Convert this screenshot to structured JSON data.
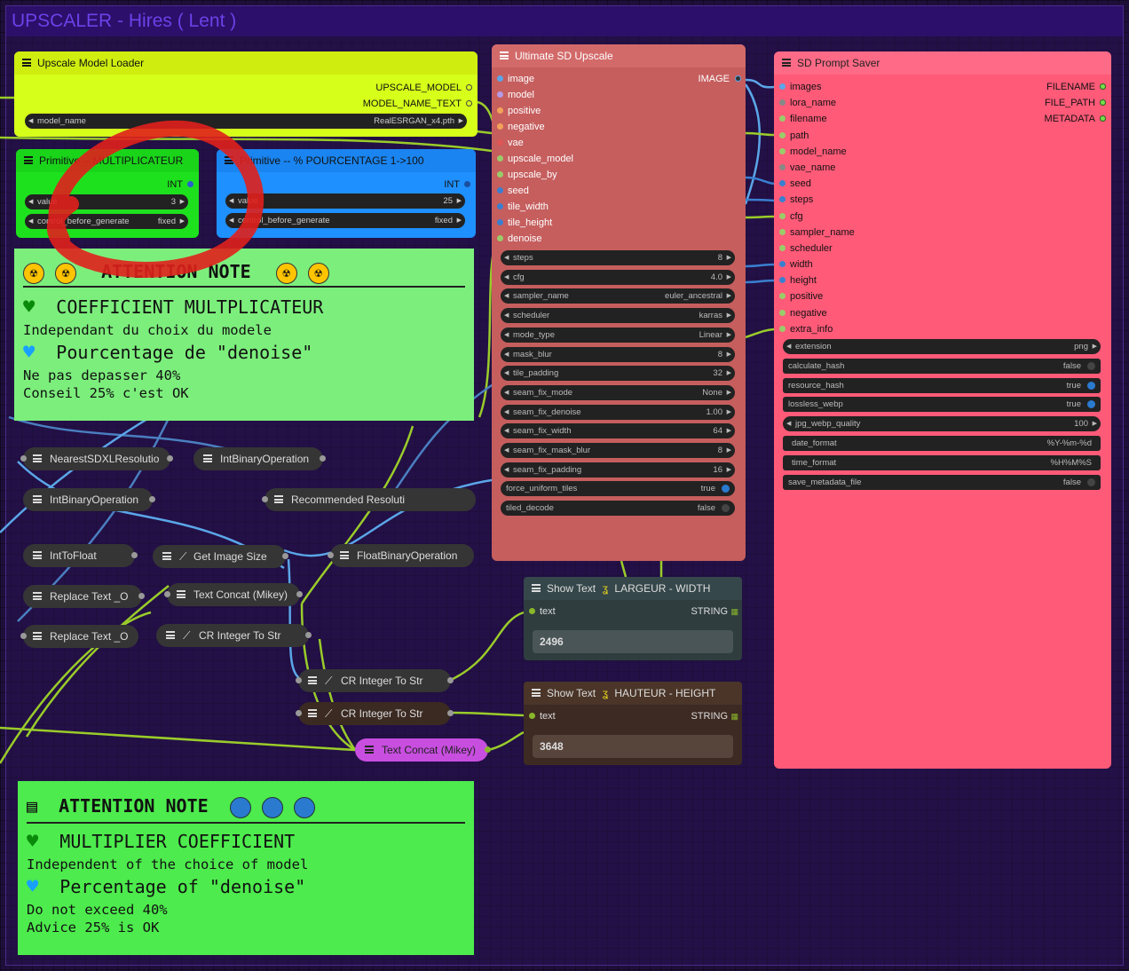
{
  "group": {
    "title": "UPSCALER - Hires  ( Lent )"
  },
  "upscale_loader": {
    "title": "Upscale Model Loader",
    "outputs": [
      "UPSCALE_MODEL",
      "MODEL_NAME_TEXT"
    ],
    "widget": {
      "label": "model_name",
      "value": "RealESRGAN_x4.pth"
    }
  },
  "prim_mult": {
    "title": "Primitive -- MULTIPLICATEUR",
    "output": "INT",
    "widgets": [
      {
        "label": "value",
        "value": "3"
      },
      {
        "label": "control_before_generate",
        "value": "fixed"
      }
    ]
  },
  "prim_pct": {
    "title": "Primitive -- % POURCENTAGE 1->100",
    "output": "INT",
    "widgets": [
      {
        "label": "value",
        "value": "25"
      },
      {
        "label": "control_before_generate",
        "value": "fixed"
      }
    ]
  },
  "note_fr": {
    "header": "ATTENTION NOTE",
    "line1": "COEFFICIENT MULTPLICATEUR",
    "line2": "Independant du choix du modele",
    "line3": "Pourcentage de \"denoise\"",
    "line4": "Ne pas depasser 40%",
    "line5": "Conseil 25% c'est OK"
  },
  "note_en": {
    "header": "ATTENTION NOTE",
    "line1": "MULTIPLIER COEFFICIENT",
    "line2": "Independent of the choice of model",
    "line3": "Percentage of \"denoise\"",
    "line4": "Do not exceed 40%",
    "line5": "Advice 25% is OK"
  },
  "ultimate": {
    "title": "Ultimate SD Upscale",
    "output": "IMAGE",
    "inputs": [
      {
        "name": "image",
        "color": "#5aa6e8"
      },
      {
        "name": "model",
        "color": "#b69ae6"
      },
      {
        "name": "positive",
        "color": "#f2a35a"
      },
      {
        "name": "negative",
        "color": "#f2a35a"
      },
      {
        "name": "vae",
        "color": "#e05555"
      },
      {
        "name": "upscale_model",
        "color": "#9acc6a"
      },
      {
        "name": "upscale_by",
        "color": "#9acc6a"
      },
      {
        "name": "seed",
        "color": "#3a7fd0"
      },
      {
        "name": "tile_width",
        "color": "#3a7fd0"
      },
      {
        "name": "tile_height",
        "color": "#3a7fd0"
      },
      {
        "name": "denoise",
        "color": "#9acc6a"
      }
    ],
    "widgets": [
      {
        "label": "steps",
        "value": "8"
      },
      {
        "label": "cfg",
        "value": "4.0"
      },
      {
        "label": "sampler_name",
        "value": "euler_ancestral"
      },
      {
        "label": "scheduler",
        "value": "karras"
      },
      {
        "label": "mode_type",
        "value": "Linear"
      },
      {
        "label": "mask_blur",
        "value": "8"
      },
      {
        "label": "tile_padding",
        "value": "32"
      },
      {
        "label": "seam_fix_mode",
        "value": "None"
      },
      {
        "label": "seam_fix_denoise",
        "value": "1.00"
      },
      {
        "label": "seam_fix_width",
        "value": "64"
      },
      {
        "label": "seam_fix_mask_blur",
        "value": "8"
      },
      {
        "label": "seam_fix_padding",
        "value": "16"
      }
    ],
    "toggles": [
      {
        "label": "force_uniform_tiles",
        "value": "true"
      },
      {
        "label": "tiled_decode",
        "value": "false"
      }
    ]
  },
  "prompt_saver": {
    "title": "SD Prompt Saver",
    "outputs": [
      "FILENAME",
      "FILE_PATH",
      "METADATA"
    ],
    "inputs": [
      {
        "name": "images",
        "color": "#5aa6e8"
      },
      {
        "name": "lora_name",
        "color": "#888888"
      },
      {
        "name": "filename",
        "color": "#9acc6a"
      },
      {
        "name": "path",
        "color": "#9acc6a"
      },
      {
        "name": "model_name",
        "color": "#9acc6a"
      },
      {
        "name": "vae_name",
        "color": "#888888"
      },
      {
        "name": "seed",
        "color": "#3a7fd0"
      },
      {
        "name": "steps",
        "color": "#3a7fd0"
      },
      {
        "name": "cfg",
        "color": "#9acc6a"
      },
      {
        "name": "sampler_name",
        "color": "#9acc6a"
      },
      {
        "name": "scheduler",
        "color": "#9acc6a"
      },
      {
        "name": "width",
        "color": "#3a7fd0"
      },
      {
        "name": "height",
        "color": "#3a7fd0"
      },
      {
        "name": "positive",
        "color": "#9acc6a"
      },
      {
        "name": "negative",
        "color": "#9acc6a"
      },
      {
        "name": "extra_info",
        "color": "#9acc6a"
      }
    ],
    "widgets": [
      {
        "label": "extension",
        "value": "png",
        "kind": "combo"
      },
      {
        "label": "calculate_hash",
        "value": "false",
        "kind": "toggle"
      },
      {
        "label": "resource_hash",
        "value": "true",
        "kind": "toggle"
      },
      {
        "label": "lossless_webp",
        "value": "true",
        "kind": "toggle"
      },
      {
        "label": "jpg_webp_quality",
        "value": "100",
        "kind": "combo"
      },
      {
        "label": "date_format",
        "value": "%Y-%m-%d",
        "kind": "text"
      },
      {
        "label": "time_format",
        "value": "%H%M%S",
        "kind": "text"
      },
      {
        "label": "save_metadata_file",
        "value": "false",
        "kind": "toggle"
      }
    ]
  },
  "collapsed": {
    "nearest": "NearestSDXLResolutio",
    "intbin1": "IntBinaryOperation",
    "intbin2": "IntBinaryOperation",
    "recommended": "Recommended Resoluti",
    "inttofloat": "IntToFloat",
    "getimagesize": "Get Image Size",
    "floatbin": "FloatBinaryOperation",
    "replace1": "Replace Text _O",
    "textconcat1": "Text Concat (Mikey)",
    "replace2": "Replace Text _O",
    "crint1": "CR Integer To Str",
    "crint2": "CR Integer To Str",
    "crint3": "CR Integer To Str",
    "textconcat2": "Text Concat (Mikey)"
  },
  "show_width": {
    "title": "Show Text",
    "suffix": "LARGEUR - WIDTH",
    "input": "text",
    "output": "STRING",
    "value": "2496"
  },
  "show_height": {
    "title": "Show Text",
    "suffix": "HAUTEUR - HEIGHT",
    "input": "text",
    "output": "STRING",
    "value": "3648"
  },
  "colors": {
    "loader": "#d6ff1a",
    "primitive_green": "#1ee11e",
    "primitive_blue": "#1e90ff",
    "note_fr": "#7cee7c",
    "note_en": "#4deb4d",
    "ultimate": "#c65e5e",
    "saver": "#ff5a78",
    "collapsed": "#353535",
    "text_concat": "#c84ee0"
  }
}
